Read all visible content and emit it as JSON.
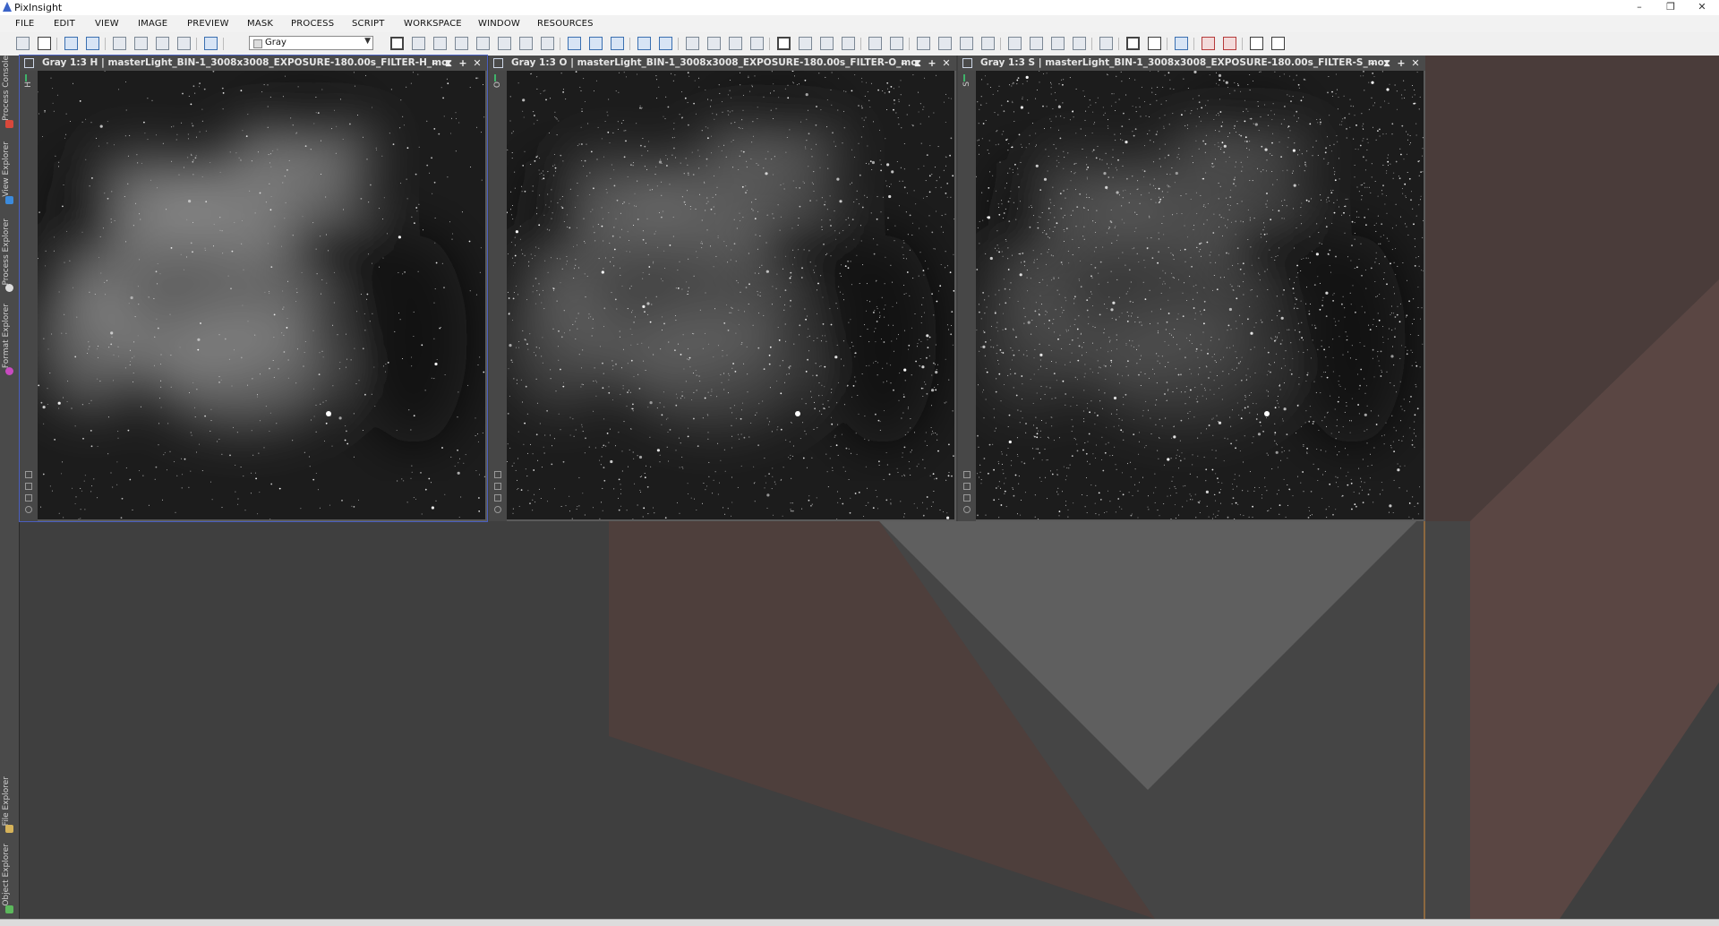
{
  "app": {
    "title": "PixInsight"
  },
  "window_controls": {
    "minimize": "–",
    "restore": "❐",
    "close": "✕"
  },
  "menu": {
    "items": [
      "FILE",
      "EDIT",
      "VIEW",
      "IMAGE",
      "PREVIEW",
      "MASK",
      "PROCESS",
      "SCRIPT",
      "WORKSPACE",
      "WINDOW",
      "RESOURCES"
    ]
  },
  "toolbar": {
    "channel_select": {
      "value": "Gray"
    },
    "icons": [
      "new-image-icon",
      "color-image-icon",
      "undo-icon",
      "redo-icon",
      "open-icon",
      "save-icon",
      "save-as-icon",
      "close-image-icon",
      "blue-sphere-icon",
      "pan-mode-icon",
      "fit-view-icon",
      "zoom-fit-icon",
      "move-icon",
      "readout-mode-icon",
      "preview-icon",
      "select-icon",
      "pointer-icon",
      "zoom-in-icon",
      "zoom-out-icon",
      "zoom-1-1-icon",
      "zoom-in-2-icon",
      "zoom-out-2-icon",
      "window-arrange-icon",
      "window-fit-icon",
      "window-maximize-icon",
      "window-tile-icon",
      "stf-icon",
      "auto-stf-icon",
      "stf-reset-icon",
      "histogram-icon",
      "mask-icon",
      "mask-show-icon",
      "mask-invert-icon",
      "mask-enable-icon",
      "mask-edit-icon",
      "preview-new-icon",
      "preview-delete-icon",
      "process-container-icon",
      "console-icon",
      "explorer-icon",
      "history-icon",
      "screen-icon",
      "image-icon",
      "script-icon",
      "red-alert-icon",
      "red-bookmark-icon",
      "gear-yellow-icon",
      "run-icon"
    ]
  },
  "left_dock": {
    "top_tabs": [
      "Process Console",
      "View Explorer",
      "Process Explorer",
      "Format Explorer"
    ],
    "bottom_tabs": [
      "File Explorer",
      "Object Explorer"
    ]
  },
  "image_windows": [
    {
      "title": "Gray 1:3 H | masterLight_BIN-1_3008x3008_EXPOSURE-180.00s_FILTER-H_mo...",
      "side_label": "H",
      "active": true,
      "seed": 11,
      "star_count": 700,
      "nebula": 0.95
    },
    {
      "title": "Gray 1:3 O | masterLight_BIN-1_3008x3008_EXPOSURE-180.00s_FILTER-O_mo...",
      "side_label": "O",
      "active": false,
      "seed": 23,
      "star_count": 1700,
      "nebula": 0.55
    },
    {
      "title": "Gray 1:3 S | masterLight_BIN-1_3008x3008_EXPOSURE-180.00s_FILTER-S_mo...",
      "side_label": "S",
      "active": false,
      "seed": 37,
      "star_count": 2400,
      "nebula": 0.4
    }
  ],
  "image_window_buttons": {
    "shade": "–",
    "minimize": "⧗",
    "maximize": "+",
    "close": "✕"
  },
  "colors": {
    "titlebar": "#4a4a4a",
    "workspace": "#3f3f3f",
    "accent_orange": "#d28a3c",
    "wedge_brown": "#5a4440",
    "wedge_gray": "#6a6a6a"
  }
}
